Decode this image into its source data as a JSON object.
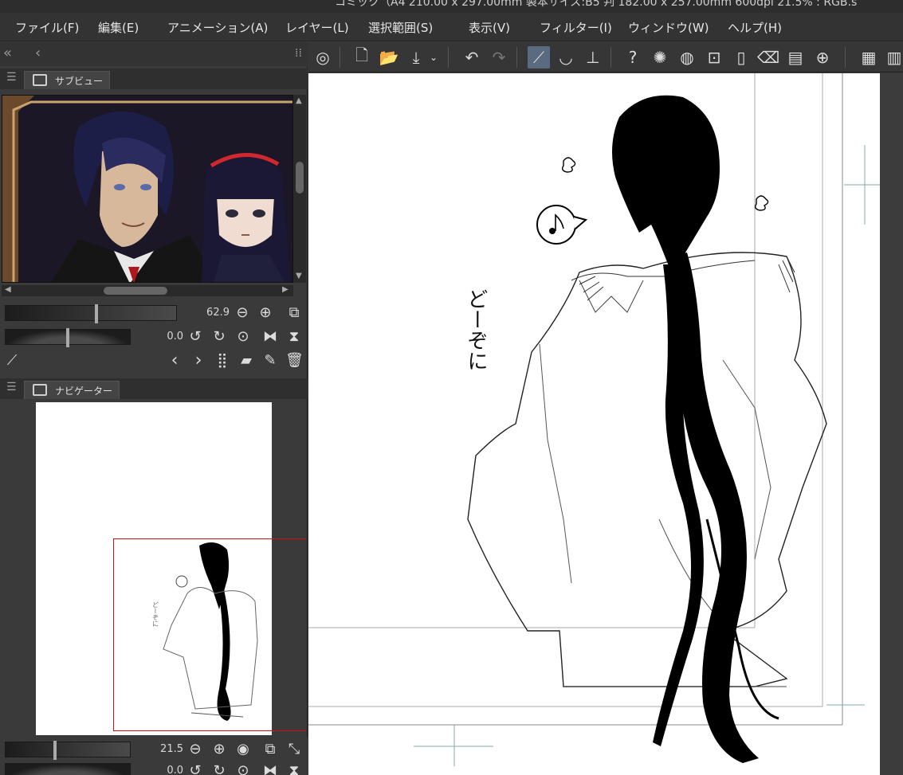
{
  "window": {
    "title": "コミック（A4 210.00 x 297.00mm 製本サイズ:B5 判 182.00 x 257.00mm 600dpi 21.5% : RGB.s"
  },
  "menu": [
    "ファイル(F)",
    "編集(E)",
    "アニメーション(A)",
    "レイヤー(L)",
    "選択範囲(S)",
    "表示(V)",
    "フィルター(I)",
    "ウィンドウ(W)",
    "ヘルプ(H)"
  ],
  "subview": {
    "tab_label": "サブビュー",
    "zoom_value": "62.9",
    "rotate_value": "0.0"
  },
  "navigator": {
    "tab_label": "ナビゲーター",
    "zoom_value": "21.5",
    "rotate_value": "0.0"
  },
  "canvas": {
    "handwritten_text": "どーぞに"
  },
  "icons": {
    "panel_collapse": "double-chevron-left-icon",
    "back": "chevron-left-icon",
    "eyedropper": "eyedropper-icon"
  }
}
